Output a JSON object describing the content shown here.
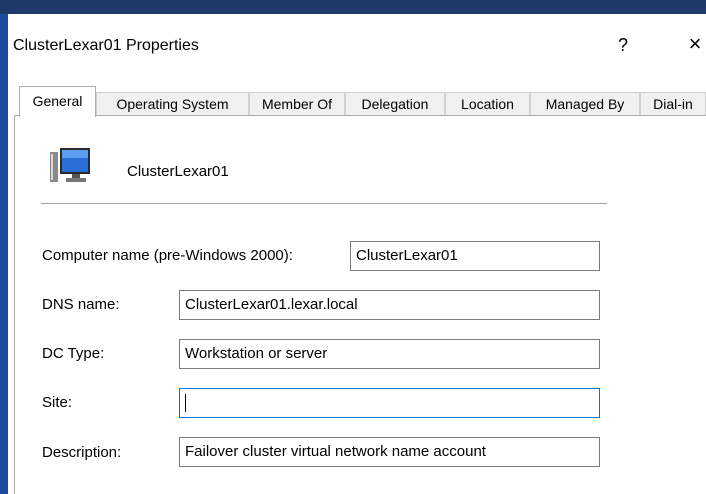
{
  "window": {
    "title": "ClusterLexar01 Properties",
    "help_glyph": "?",
    "close_glyph": "×"
  },
  "tabs": [
    {
      "label": "General",
      "active": true
    },
    {
      "label": "Operating System",
      "active": false
    },
    {
      "label": "Member Of",
      "active": false
    },
    {
      "label": "Delegation",
      "active": false
    },
    {
      "label": "Location",
      "active": false
    },
    {
      "label": "Managed By",
      "active": false
    },
    {
      "label": "Dial-in",
      "active": false
    }
  ],
  "general": {
    "object_icon": "computer-icon",
    "object_name": "ClusterLexar01",
    "fields": {
      "computer_name": {
        "label": "Computer name (pre-Windows 2000):",
        "value": "ClusterLexar01"
      },
      "dns_name": {
        "label": "DNS name:",
        "value": "ClusterLexar01.lexar.local"
      },
      "dc_type": {
        "label": "DC Type:",
        "value": "Workstation or server"
      },
      "site": {
        "label": "Site:",
        "value": ""
      },
      "description": {
        "label": "Description:",
        "value": "Failover cluster virtual network name account"
      }
    }
  },
  "colors": {
    "focus_border": "#0078d7",
    "taskbar": "#1f3a68",
    "window_edge": "#1e4aa0"
  }
}
